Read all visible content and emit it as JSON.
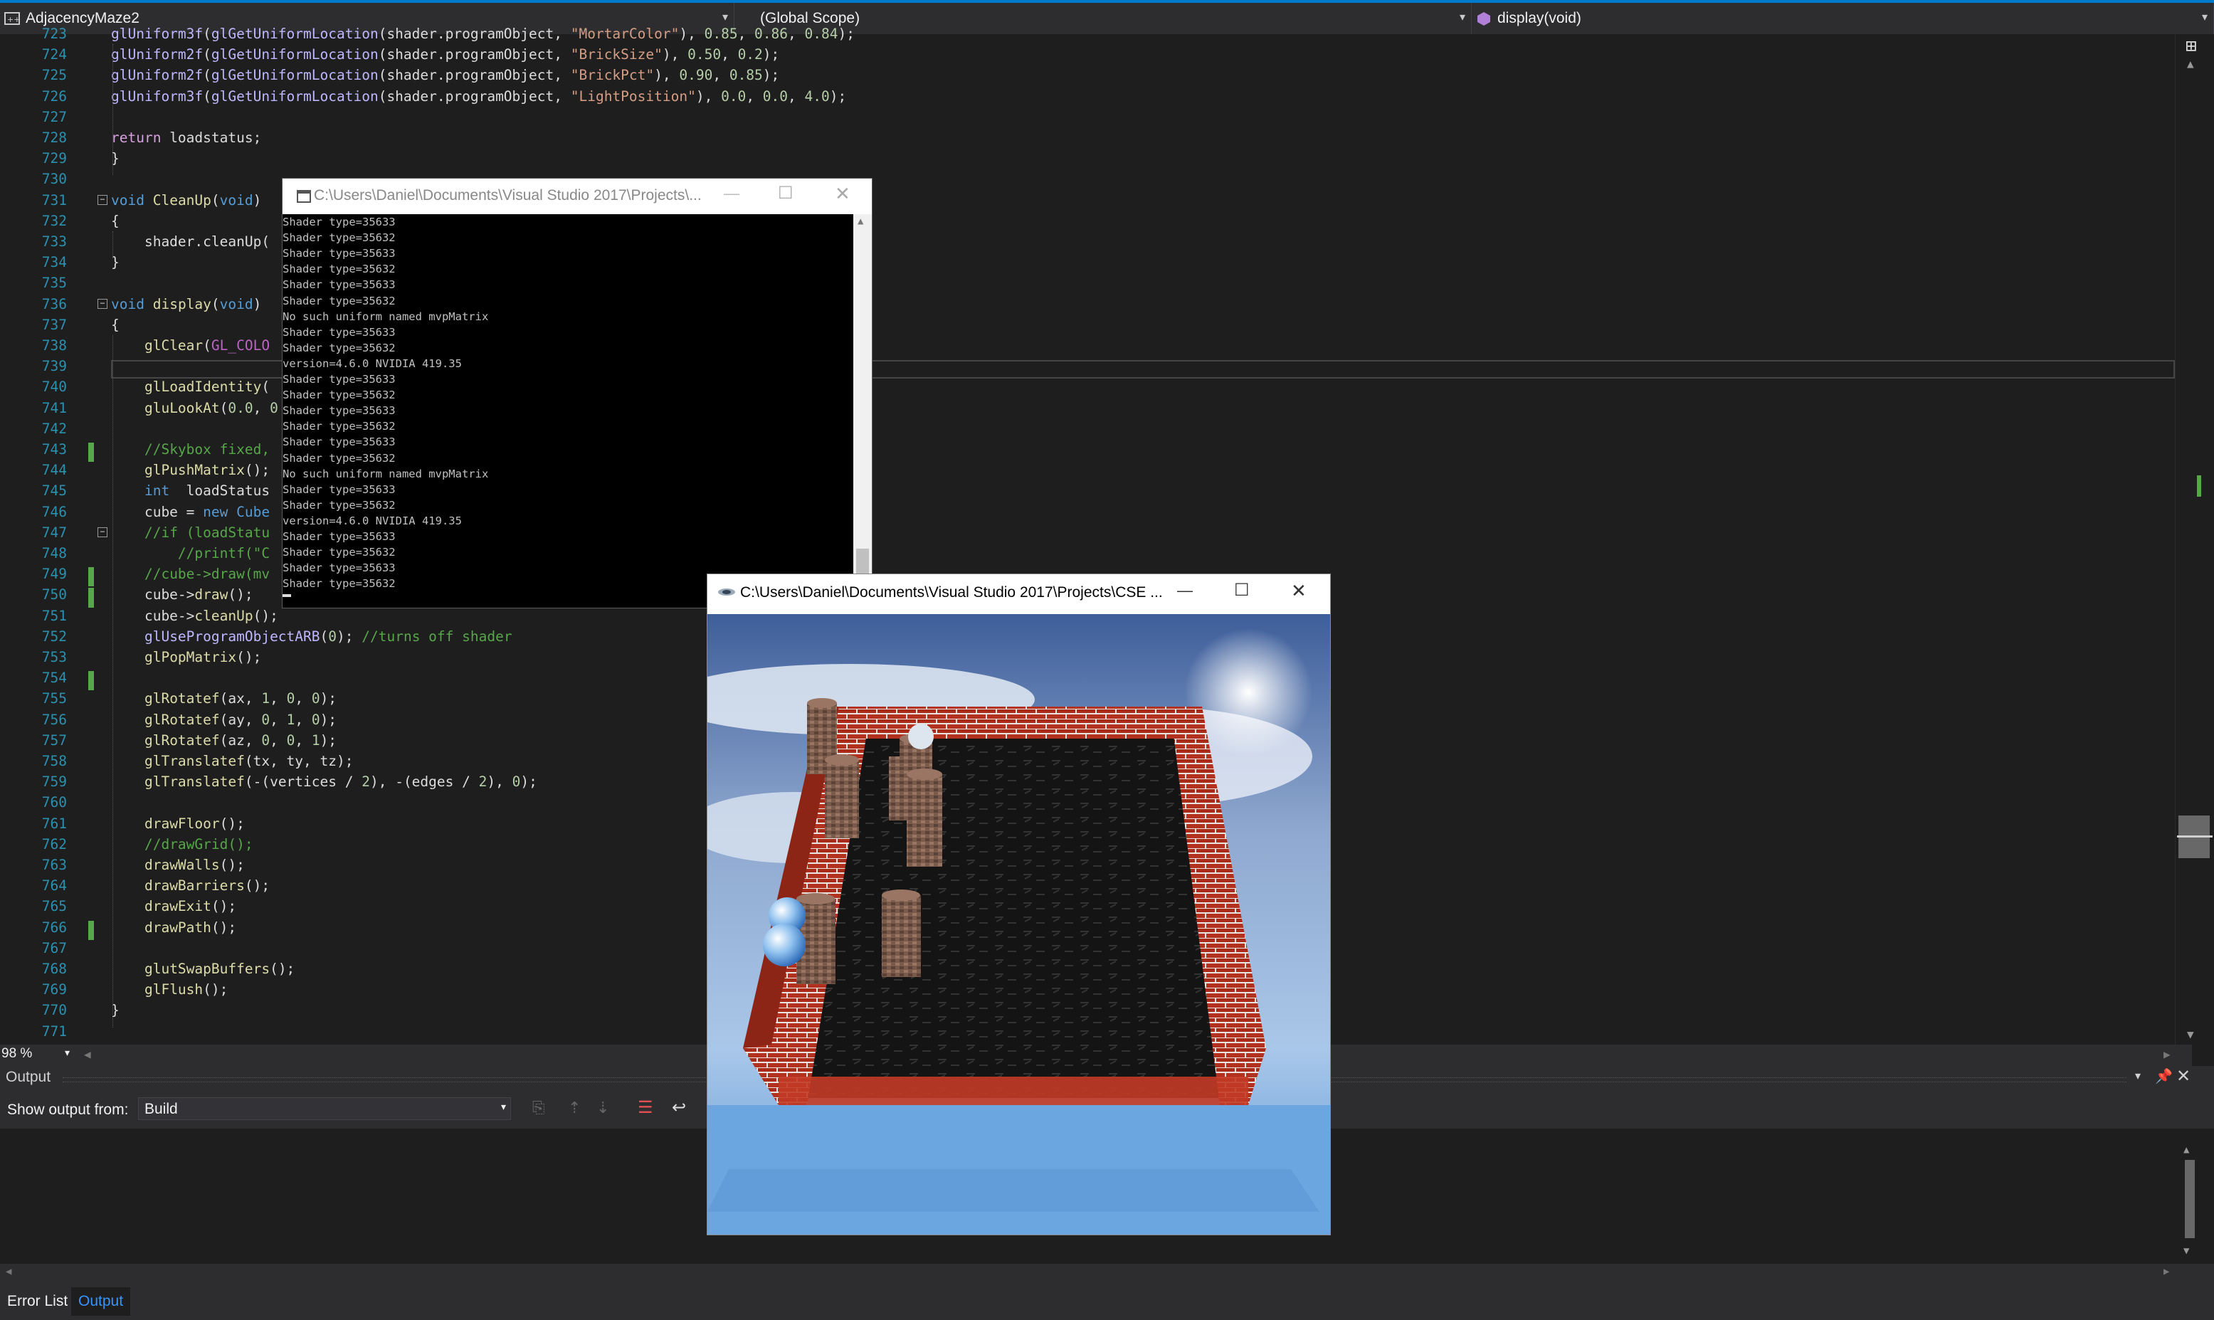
{
  "navbar": {
    "project": "AdjacencyMaze2",
    "scope": "(Global Scope)",
    "member": "display(void)"
  },
  "code_lines": [
    {
      "n": "723",
      "html": "<span class=\"gl\">glUniform3f</span>(<span class=\"gl\">glGetUniformLocation</span>(shader.programObject, <span class=\"str\">\"MortarColor\"</span>), <span class=\"num\">0.85</span>, <span class=\"num\">0.86</span>, <span class=\"num\">0.84</span>);"
    },
    {
      "n": "724",
      "html": "<span class=\"gl\">glUniform2f</span>(<span class=\"gl\">glGetUniformLocation</span>(shader.programObject, <span class=\"str\">\"BrickSize\"</span>), <span class=\"num\">0.50</span>, <span class=\"num\">0.2</span>);"
    },
    {
      "n": "725",
      "html": "<span class=\"gl\">glUniform2f</span>(<span class=\"gl\">glGetUniformLocation</span>(shader.programObject, <span class=\"str\">\"BrickPct\"</span>), <span class=\"num\">0.90</span>, <span class=\"num\">0.85</span>);"
    },
    {
      "n": "726",
      "html": "<span class=\"gl\">glUniform3f</span>(<span class=\"gl\">glGetUniformLocation</span>(shader.programObject, <span class=\"str\">\"LightPosition\"</span>), <span class=\"num\">0.0</span>, <span class=\"num\">0.0</span>, <span class=\"num\">4.0</span>);"
    },
    {
      "n": "727",
      "html": ""
    },
    {
      "n": "728",
      "html": "<span class=\"pur\">return</span> loadstatus;"
    },
    {
      "n": "729",
      "html": "}"
    },
    {
      "n": "730",
      "html": ""
    },
    {
      "n": "731",
      "html": "<span class=\"kw\">void</span> <span class=\"fn\">CleanUp</span>(<span class=\"kw\">void</span>)"
    },
    {
      "n": "732",
      "html": "{"
    },
    {
      "n": "733",
      "html": "    shader.cleanUp("
    },
    {
      "n": "734",
      "html": "}"
    },
    {
      "n": "735",
      "html": ""
    },
    {
      "n": "736",
      "html": "<span class=\"kw\">void</span> <span class=\"fn\">display</span>(<span class=\"kw\">void</span>)"
    },
    {
      "n": "737",
      "html": "{"
    },
    {
      "n": "738",
      "html": "    <span class=\"fn\">glClear</span>(<span class=\"mac\">GL_COLO</span>"
    },
    {
      "n": "739",
      "html": ""
    },
    {
      "n": "740",
      "html": "    <span class=\"fn\">glLoadIdentity</span>("
    },
    {
      "n": "741",
      "html": "    <span class=\"fn\">gluLookAt</span>(<span class=\"num\">0.0</span>, <span class=\"num\">0</span>"
    },
    {
      "n": "742",
      "html": ""
    },
    {
      "n": "743",
      "html": "    <span class=\"cm\">//Skybox fixed,</span>"
    },
    {
      "n": "744",
      "html": "    <span class=\"fn\">glPushMatrix</span>();"
    },
    {
      "n": "745",
      "html": "    <span class=\"kw\">int</span>  loadStatus"
    },
    {
      "n": "746",
      "html": "    cube = <span class=\"kw\">new</span> <span class=\"kw\">Cube</span>"
    },
    {
      "n": "747",
      "html": "    <span class=\"cm\">//if (loadStatu</span>"
    },
    {
      "n": "748",
      "html": "    <span class=\"cm\">    //printf(\"C</span>"
    },
    {
      "n": "749",
      "html": "    <span class=\"cm\">//cube->draw(mv</span>"
    },
    {
      "n": "750",
      "html": "    cube-><span class=\"fn\">draw</span>();"
    },
    {
      "n": "751",
      "html": "    cube-><span class=\"fn\">cleanUp</span>();"
    },
    {
      "n": "752",
      "html": "    <span class=\"gl\">glUseProgramObjectARB</span>(<span class=\"num\">0</span>); <span class=\"cm\">//turns off shader</span>"
    },
    {
      "n": "753",
      "html": "    <span class=\"fn\">glPopMatrix</span>();"
    },
    {
      "n": "754",
      "html": ""
    },
    {
      "n": "755",
      "html": "    <span class=\"fn\">glRotatef</span>(ax, <span class=\"num\">1</span>, <span class=\"num\">0</span>, <span class=\"num\">0</span>);"
    },
    {
      "n": "756",
      "html": "    <span class=\"fn\">glRotatef</span>(ay, <span class=\"num\">0</span>, <span class=\"num\">1</span>, <span class=\"num\">0</span>);"
    },
    {
      "n": "757",
      "html": "    <span class=\"fn\">glRotatef</span>(az, <span class=\"num\">0</span>, <span class=\"num\">0</span>, <span class=\"num\">1</span>);"
    },
    {
      "n": "758",
      "html": "    <span class=\"fn\">glTranslatef</span>(tx, ty, tz);"
    },
    {
      "n": "759",
      "html": "    <span class=\"fn\">glTranslatef</span>(-(vertices / <span class=\"num\">2</span>), -(edges / <span class=\"num\">2</span>), <span class=\"num\">0</span>);"
    },
    {
      "n": "760",
      "html": ""
    },
    {
      "n": "761",
      "html": "    <span class=\"fn\">drawFloor</span>();"
    },
    {
      "n": "762",
      "html": "    <span class=\"cm\">//drawGrid();</span>"
    },
    {
      "n": "763",
      "html": "    <span class=\"fn\">drawWalls</span>();"
    },
    {
      "n": "764",
      "html": "    <span class=\"fn\">drawBarriers</span>();"
    },
    {
      "n": "765",
      "html": "    <span class=\"fn\">drawExit</span>();"
    },
    {
      "n": "766",
      "html": "    <span class=\"fn\">drawPath</span>();"
    },
    {
      "n": "767",
      "html": ""
    },
    {
      "n": "768",
      "html": "    <span class=\"fn\">glutSwapBuffers</span>();"
    },
    {
      "n": "769",
      "html": "    <span class=\"fn\">glFlush</span>();"
    },
    {
      "n": "770",
      "html": "}"
    },
    {
      "n": "771",
      "html": ""
    }
  ],
  "console": {
    "title": "C:\\Users\\Daniel\\Documents\\Visual Studio 2017\\Projects\\...",
    "lines": [
      "Shader type=35633",
      "Shader type=35632",
      "Shader type=35633",
      "Shader type=35632",
      "Shader type=35633",
      "Shader type=35632",
      "No such uniform named mvpMatrix",
      "Shader type=35633",
      "Shader type=35632",
      "version=4.6.0 NVIDIA 419.35",
      "Shader type=35633",
      "Shader type=35632",
      "Shader type=35633",
      "Shader type=35632",
      "Shader type=35633",
      "Shader type=35632",
      "No such uniform named mvpMatrix",
      "Shader type=35633",
      "Shader type=35632",
      "version=4.6.0 NVIDIA 419.35",
      "Shader type=35633",
      "Shader type=35632",
      "Shader type=35633",
      "Shader type=35632"
    ]
  },
  "glut": {
    "title": "C:\\Users\\Daniel\\Documents\\Visual Studio 2017\\Projects\\CSE ..."
  },
  "zoom": "98 %",
  "output": {
    "header": "Output",
    "show_from_label": "Show output from:",
    "source": "Build"
  },
  "bottom_tabs": [
    "Error List",
    "Output"
  ],
  "colors": {
    "accent": "#007acc",
    "editor_bg": "#1e1e1e",
    "chrome_bg": "#2d2d30"
  }
}
